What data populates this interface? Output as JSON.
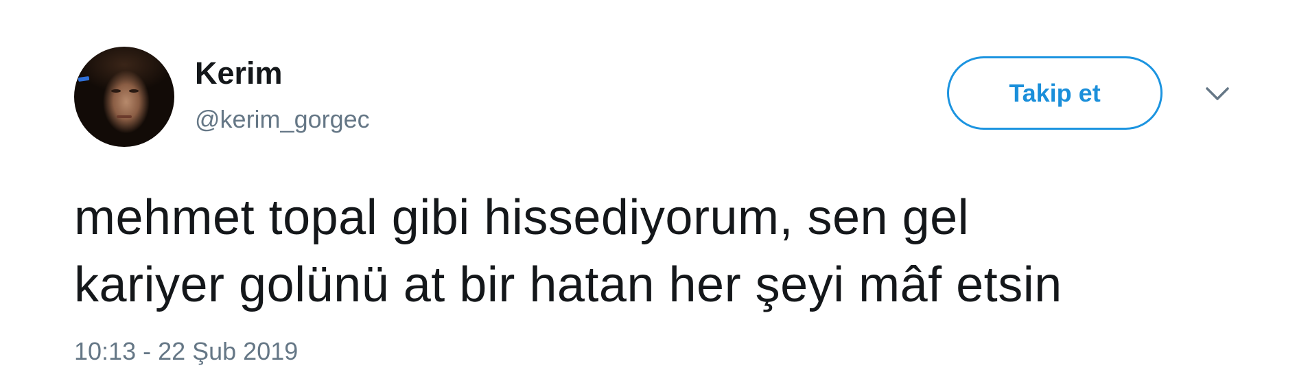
{
  "user": {
    "display_name": "Kerim",
    "handle": "@kerim_gorgec"
  },
  "actions": {
    "follow_label": "Takip et",
    "more_icon": "chevron-down-icon"
  },
  "tweet": {
    "line1": "mehmet topal gibi hissediyorum, sen gel",
    "line2": "kariyer golünü at bir hatan her şeyi mâf etsin",
    "timestamp": "10:13 - 22 Şub 2019"
  },
  "colors": {
    "accent": "#1da1f2",
    "text": "#14171a",
    "muted": "#657786"
  }
}
